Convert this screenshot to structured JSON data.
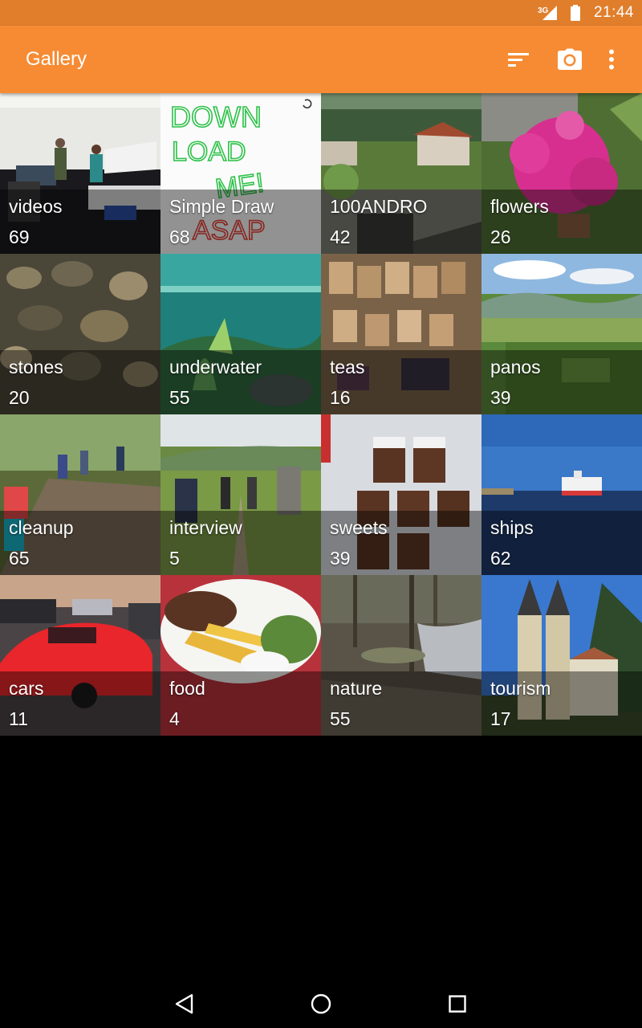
{
  "status": {
    "network_label": "3G",
    "time": "21:44",
    "icons": [
      "signal-icon",
      "battery-icon"
    ]
  },
  "appbar": {
    "title": "Gallery",
    "actions": [
      {
        "name": "sort-icon"
      },
      {
        "name": "camera-icon"
      },
      {
        "name": "more-options-icon"
      }
    ],
    "colors": {
      "appbar": "#F68B33",
      "statusbar": "#E17E2C"
    }
  },
  "folders": [
    {
      "name": "videos",
      "count": "69"
    },
    {
      "name": "Simple Draw",
      "count": "68"
    },
    {
      "name": "100ANDRO",
      "count": "42"
    },
    {
      "name": "flowers",
      "count": "26"
    },
    {
      "name": "stones",
      "count": "20"
    },
    {
      "name": "underwater",
      "count": "55"
    },
    {
      "name": "teas",
      "count": "16"
    },
    {
      "name": "panos",
      "count": "39"
    },
    {
      "name": "cleanup",
      "count": "65"
    },
    {
      "name": "interview",
      "count": "5"
    },
    {
      "name": "sweets",
      "count": "39"
    },
    {
      "name": "ships",
      "count": "62"
    },
    {
      "name": "cars",
      "count": "11"
    },
    {
      "name": "food",
      "count": "4"
    },
    {
      "name": "nature",
      "count": "55"
    },
    {
      "name": "tourism",
      "count": "17"
    }
  ],
  "simple_draw_text": [
    "DOWN",
    "LOAD",
    "ME!",
    "ASAP"
  ],
  "navbar": {
    "buttons": [
      "back-icon",
      "home-icon",
      "recents-icon"
    ]
  }
}
